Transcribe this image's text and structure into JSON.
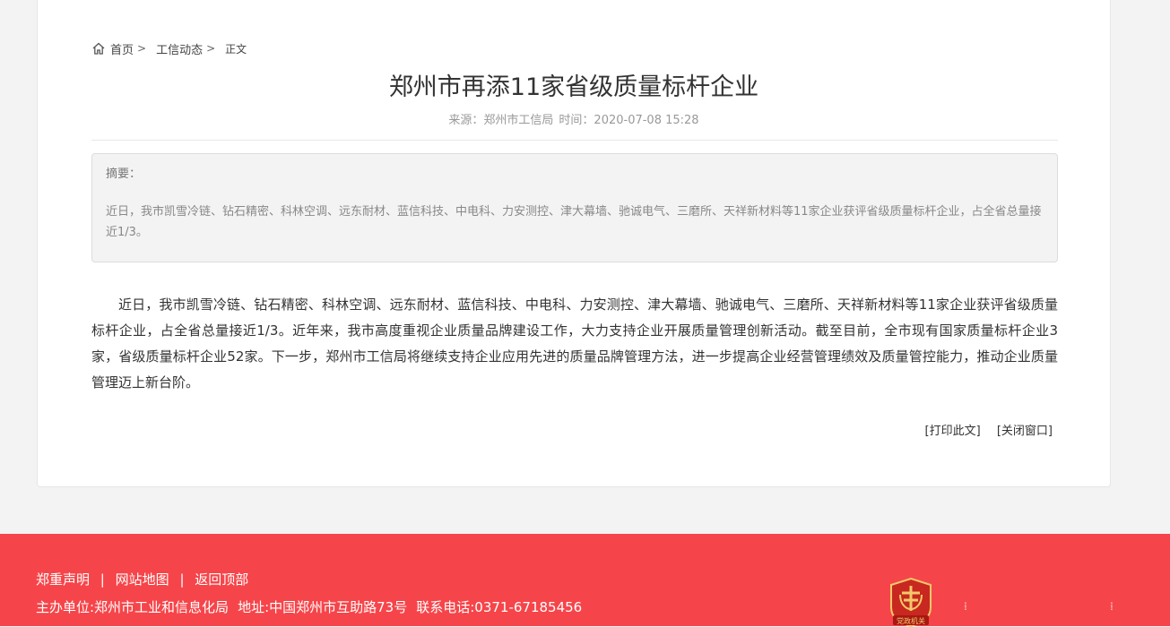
{
  "breadcrumb": {
    "home": "首页",
    "section": "工信动态",
    "current": "正文"
  },
  "article": {
    "title": "郑州市再添11家省级质量标杆企业",
    "source": "来源：郑州市工信局",
    "time": "时间：2020-07-08 15:28",
    "abstract_label": "摘要：",
    "abstract_text": "近日，我市凯雪冷链、钻石精密、科林空调、远东耐材、蓝信科技、中电科、力安测控、津大幕墙、驰诚电气、三磨所、天祥新材料等11家企业获评省级质量标杆企业，占全省总量接近1/3。",
    "body": "近日，我市凯雪冷链、钻石精密、科林空调、远东耐材、蓝信科技、中电科、力安测控、津大幕墙、驰诚电气、三磨所、天祥新材料等11家企业获评省级质量标杆企业，占全省总量接近1/3。近年来，我市高度重视企业质量品牌建设工作，大力支持企业开展质量管理创新活动。截至目前，全市现有国家质量标杆企业3家，省级质量标杆企业52家。下一步，郑州市工信局将继续支持企业应用先进的质量品牌管理方法，进一步提高企业经营管理绩效及质量管控能力，推动企业质量管理迈上新台阶。"
  },
  "tools": {
    "print": "[打印此文]",
    "close": "[关闭窗口]"
  },
  "footer": {
    "links": [
      "郑重声明",
      "网站地图",
      "返回顶部"
    ],
    "separator": "|",
    "host": "主办单位:郑州市工业和信息化局",
    "address": "地址:中国郑州市互助路73号",
    "phone": "联系电话:0371-67185456",
    "badge_text": "党政机关",
    "colors": {
      "footer_bg": "#f6454a",
      "badge": "#c8281f"
    }
  },
  "icons": {
    "home": "home-icon",
    "chevron": "chevron-right-icon",
    "badge": "party-government-badge-icon"
  }
}
